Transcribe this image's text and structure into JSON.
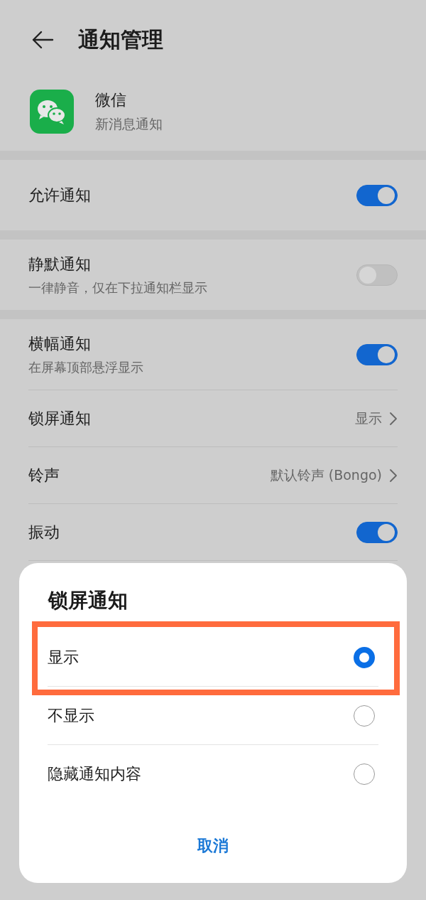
{
  "header": {
    "title": "通知管理"
  },
  "app": {
    "name": "微信",
    "subtitle": "新消息通知"
  },
  "sections": [
    {
      "rows": [
        {
          "kind": "toggle",
          "label": "允许通知",
          "on": true
        }
      ]
    },
    {
      "rows": [
        {
          "kind": "toggle",
          "label": "静默通知",
          "subtitle": "一律静音，仅在下拉通知栏显示",
          "on": false
        }
      ]
    },
    {
      "rows": [
        {
          "kind": "toggle",
          "label": "横幅通知",
          "subtitle": "在屏幕顶部悬浮显示",
          "on": true
        },
        {
          "kind": "link",
          "label": "锁屏通知",
          "value": "显示"
        },
        {
          "kind": "link",
          "label": "铃声",
          "value": "默认铃声 (Bongo)"
        },
        {
          "kind": "toggle",
          "label": "振动",
          "on": true
        },
        {
          "kind": "hidden"
        }
      ]
    }
  ],
  "dialog": {
    "title": "锁屏通知",
    "options": [
      {
        "label": "显示",
        "selected": true,
        "highlighted": true
      },
      {
        "label": "不显示",
        "selected": false,
        "highlighted": false
      },
      {
        "label": "隐藏通知内容",
        "selected": false,
        "highlighted": false
      }
    ],
    "cancel": "取消"
  }
}
